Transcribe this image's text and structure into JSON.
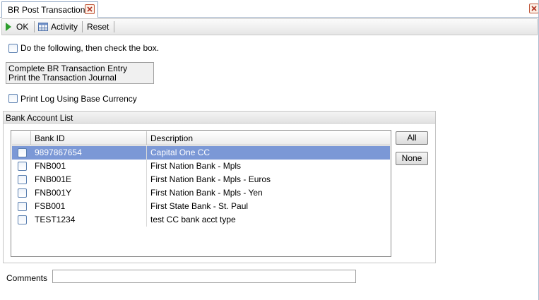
{
  "tab": {
    "title": "BR Post Transactions"
  },
  "toolbar": {
    "ok_label": "OK",
    "activity_label": "Activity",
    "reset_label": "Reset"
  },
  "instruction": {
    "checkbox_label": "Do the following, then check the box.",
    "steps": [
      "Complete BR Transaction Entry",
      "Print the Transaction Journal"
    ]
  },
  "print_log": {
    "label": "Print Log Using Base Currency"
  },
  "bank_list": {
    "title": "Bank Account List",
    "columns": {
      "bank_id": "Bank ID",
      "description": "Description"
    },
    "rows": [
      {
        "bank_id": "9897867654",
        "description": "Capital One CC"
      },
      {
        "bank_id": "FNB001",
        "description": "First Nation Bank - Mpls"
      },
      {
        "bank_id": "FNB001E",
        "description": "First Nation Bank - Mpls - Euros"
      },
      {
        "bank_id": "FNB001Y",
        "description": "First Nation Bank - Mpls - Yen"
      },
      {
        "bank_id": "FSB001",
        "description": "First State Bank - St. Paul"
      },
      {
        "bank_id": "TEST1234",
        "description": "test CC bank acct type"
      }
    ],
    "all_label": "All",
    "none_label": "None"
  },
  "comments": {
    "label": "Comments",
    "value": ""
  },
  "colors": {
    "selected_row": "#7b98d6",
    "ok_icon": "#2e9e2e",
    "close_icon": "#c0573a"
  },
  "icons": {
    "ok": "play-arrow-icon",
    "activity": "grid-table-icon",
    "close": "close-x-icon"
  }
}
